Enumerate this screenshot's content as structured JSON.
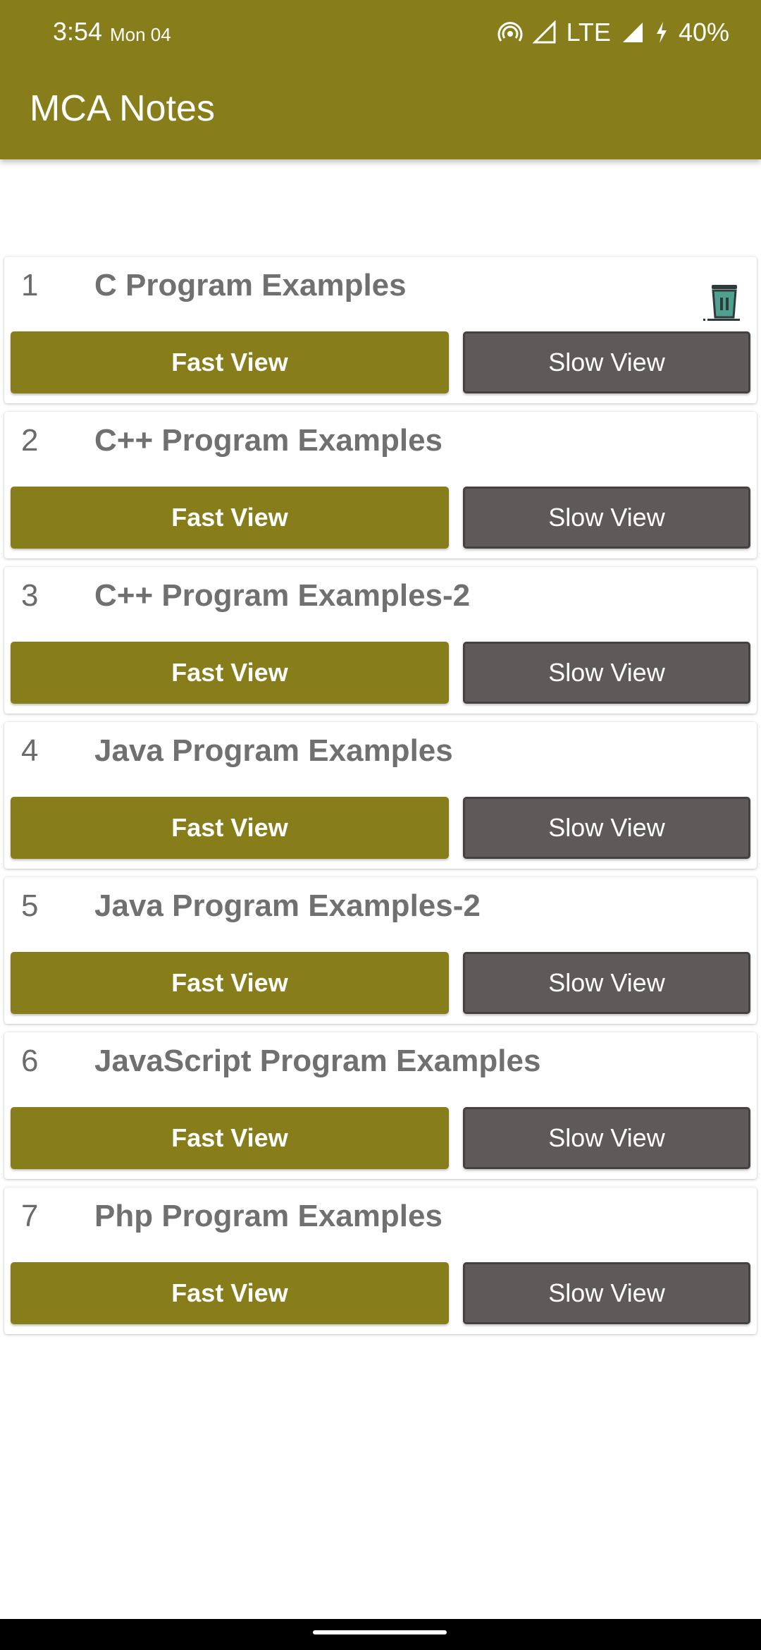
{
  "status_bar": {
    "time": "3:54",
    "date": "Mon 04",
    "network": "LTE",
    "battery": "40%"
  },
  "app_bar": {
    "title": "MCA Notes",
    "color": "#877d1a"
  },
  "items": [
    {
      "number": "1",
      "title": "C Program Examples",
      "fast_label": "Fast View",
      "slow_label": "Slow View"
    },
    {
      "number": "2",
      "title": "C++ Program Examples",
      "fast_label": "Fast View",
      "slow_label": "Slow View"
    },
    {
      "number": "3",
      "title": "C++ Program Examples-2",
      "fast_label": "Fast View",
      "slow_label": "Slow View"
    },
    {
      "number": "4",
      "title": "Java Program Examples",
      "fast_label": "Fast View",
      "slow_label": "Slow View"
    },
    {
      "number": "5",
      "title": "Java Program Examples-2",
      "fast_label": "Fast View",
      "slow_label": "Slow View"
    },
    {
      "number": "6",
      "title": "JavaScript Program Examples",
      "fast_label": "Fast View",
      "slow_label": "Slow View"
    },
    {
      "number": "7",
      "title": "Php Program Examples",
      "fast_label": "Fast View",
      "slow_label": "Slow View"
    }
  ],
  "icons": {
    "delete": "trash-icon"
  },
  "colors": {
    "fast_button": "#877d1a",
    "slow_button": "#5f5a5a"
  }
}
